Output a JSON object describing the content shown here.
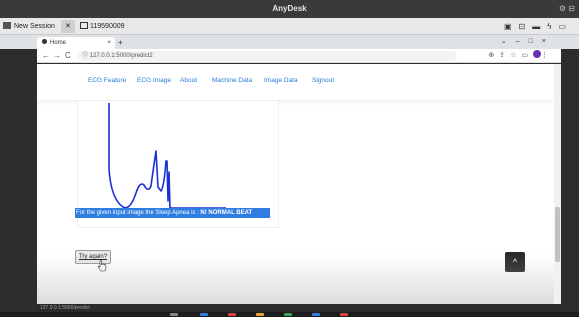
{
  "anydesk": {
    "title": "AnyDesk",
    "tabs": {
      "new_session": "New Session",
      "close": "✕",
      "remote_id": "119590009"
    },
    "tool_icons": [
      "monitor-icon",
      "chat-icon",
      "keyboard-icon",
      "lightning-icon",
      "window-icon"
    ]
  },
  "browser": {
    "tab_title": "Home",
    "tab_close": "×",
    "new_tab": "+",
    "url": "127.0.0.1:5000/predict2",
    "window_controls": [
      "⌄",
      "–",
      "□",
      "×"
    ]
  },
  "webpage": {
    "nav": [
      "ECG Feature",
      "ECG Image",
      "About",
      "Machine Data",
      "Image Data",
      "Signout"
    ],
    "result_prefix": "For the given input image the Sleep Apnea is : ",
    "result_value": "N! NORMAL BEAT",
    "try_again": "Try again?",
    "scroll_top_icon": "^"
  },
  "colors": {
    "nav_link": "#2b7bd6",
    "highlight": "#2f7de1",
    "ecg_line": "#1a2fd8",
    "anydesk_bar": "#3a3a3a"
  },
  "status": {
    "url_hint": "127.0.0.1:5000/predict"
  }
}
